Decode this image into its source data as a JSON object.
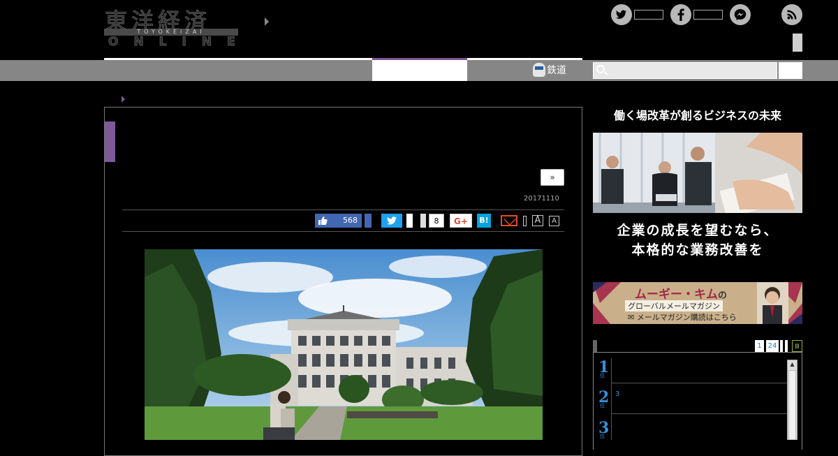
{
  "header": {
    "logo_kanji": "東洋経済",
    "logo_sub": "TOYOKEIZAI",
    "logo_online": "ONLINE"
  },
  "social": {
    "twitter_icon": "twitter-icon",
    "facebook_icon": "facebook-icon",
    "messenger_icon": "messenger-icon",
    "rss_icon": "rss-icon"
  },
  "nav": {
    "rail_label": "鉄道"
  },
  "article": {
    "next_label": "»",
    "date": "20171110"
  },
  "share": {
    "like_count": "568",
    "hatena_count": "8",
    "gplus_label": "G+",
    "hatena_label": "B!",
    "font_large": "A",
    "font_small": "A"
  },
  "sidebar": {
    "promo_title": "働く場改革が創るビジネスの未来",
    "ad_line1": "企業の成長を望むなら、",
    "ad_line2": "本格的な業務改善を",
    "mag_title_a": "ムーギー・キム",
    "mag_title_b": "の",
    "mag_sub": "グローバルメールマガジン",
    "mag_cta": "メールマガジン購読はこちら",
    "rank_tabs": [
      "1",
      "24"
    ],
    "ranking": [
      {
        "num": "1",
        "sub": "位",
        "text": ""
      },
      {
        "num": "2",
        "sub": "位",
        "text": "3"
      },
      {
        "num": "3",
        "sub": "位",
        "text": ""
      }
    ]
  },
  "colors": {
    "accent_purple": "#7c5a9a",
    "nav_gray": "#868686",
    "facebook_blue": "#4267b2",
    "twitter_blue": "#1da1f2",
    "rank_blue": "#3a8fd8"
  }
}
